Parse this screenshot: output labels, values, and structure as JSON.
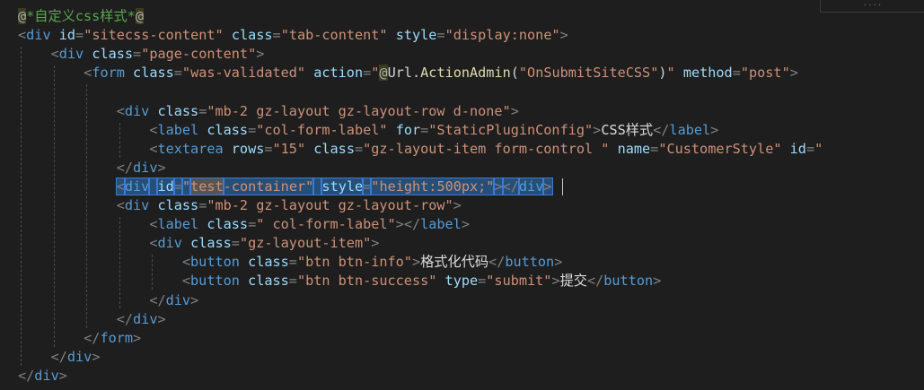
{
  "editor": {
    "scroll_hint": "....",
    "lines": [
      [
        {
          "t": "razor",
          "v": "@"
        },
        {
          "t": "comment",
          "v": "*自定义css样式*"
        },
        {
          "t": "razor",
          "v": "@"
        }
      ],
      [
        {
          "t": "punc",
          "v": "<"
        },
        {
          "t": "tag",
          "v": "div"
        },
        {
          "t": "plain",
          "v": " "
        },
        {
          "t": "attr",
          "v": "id"
        },
        {
          "t": "punc",
          "v": "="
        },
        {
          "t": "str",
          "v": "\"sitecss-content\""
        },
        {
          "t": "plain",
          "v": " "
        },
        {
          "t": "attr",
          "v": "class"
        },
        {
          "t": "punc",
          "v": "="
        },
        {
          "t": "str",
          "v": "\"tab-content\""
        },
        {
          "t": "plain",
          "v": " "
        },
        {
          "t": "attr",
          "v": "style"
        },
        {
          "t": "punc",
          "v": "="
        },
        {
          "t": "str",
          "v": "\"display:none\""
        },
        {
          "t": "punc",
          "v": ">"
        }
      ],
      [
        {
          "t": "plain",
          "v": "    "
        },
        {
          "t": "punc",
          "v": "<"
        },
        {
          "t": "tag",
          "v": "div"
        },
        {
          "t": "plain",
          "v": " "
        },
        {
          "t": "attr",
          "v": "class"
        },
        {
          "t": "punc",
          "v": "="
        },
        {
          "t": "str",
          "v": "\"page-content\""
        },
        {
          "t": "punc",
          "v": ">"
        }
      ],
      [
        {
          "t": "plain",
          "v": "        "
        },
        {
          "t": "punc",
          "v": "<"
        },
        {
          "t": "tag",
          "v": "form"
        },
        {
          "t": "plain",
          "v": " "
        },
        {
          "t": "attr",
          "v": "class"
        },
        {
          "t": "punc",
          "v": "="
        },
        {
          "t": "str",
          "v": "\"was-validated\""
        },
        {
          "t": "plain",
          "v": " "
        },
        {
          "t": "attr",
          "v": "action"
        },
        {
          "t": "punc",
          "v": "="
        },
        {
          "t": "str",
          "v": "\""
        },
        {
          "t": "razor",
          "v": "@"
        },
        {
          "t": "plain",
          "v": "Url."
        },
        {
          "t": "method",
          "v": "ActionAdmin"
        },
        {
          "t": "plain",
          "v": "("
        },
        {
          "t": "str",
          "v": "\"OnSubmitSiteCSS\""
        },
        {
          "t": "plain",
          "v": ")"
        },
        {
          "t": "str",
          "v": "\""
        },
        {
          "t": "plain",
          "v": " "
        },
        {
          "t": "attr",
          "v": "method"
        },
        {
          "t": "punc",
          "v": "="
        },
        {
          "t": "str",
          "v": "\"post\""
        },
        {
          "t": "punc",
          "v": ">"
        }
      ],
      [],
      [
        {
          "t": "plain",
          "v": "            "
        },
        {
          "t": "punc",
          "v": "<"
        },
        {
          "t": "tag",
          "v": "div"
        },
        {
          "t": "plain",
          "v": " "
        },
        {
          "t": "attr",
          "v": "class"
        },
        {
          "t": "punc",
          "v": "="
        },
        {
          "t": "str",
          "v": "\"mb-2 gz-layout gz-layout-row d-none\""
        },
        {
          "t": "punc",
          "v": ">"
        }
      ],
      [
        {
          "t": "plain",
          "v": "                "
        },
        {
          "t": "punc",
          "v": "<"
        },
        {
          "t": "tag",
          "v": "label"
        },
        {
          "t": "plain",
          "v": " "
        },
        {
          "t": "attr",
          "v": "class"
        },
        {
          "t": "punc",
          "v": "="
        },
        {
          "t": "str",
          "v": "\"col-form-label\""
        },
        {
          "t": "plain",
          "v": " "
        },
        {
          "t": "attr",
          "v": "for"
        },
        {
          "t": "punc",
          "v": "="
        },
        {
          "t": "str",
          "v": "\"StaticPluginConfig\""
        },
        {
          "t": "punc",
          "v": ">"
        },
        {
          "t": "text",
          "v": "CSS样式"
        },
        {
          "t": "punc",
          "v": "</"
        },
        {
          "t": "tag",
          "v": "label"
        },
        {
          "t": "punc",
          "v": ">"
        }
      ],
      [
        {
          "t": "plain",
          "v": "                "
        },
        {
          "t": "punc",
          "v": "<"
        },
        {
          "t": "tag",
          "v": "textarea"
        },
        {
          "t": "plain",
          "v": " "
        },
        {
          "t": "attr",
          "v": "rows"
        },
        {
          "t": "punc",
          "v": "="
        },
        {
          "t": "str",
          "v": "\"15\""
        },
        {
          "t": "plain",
          "v": " "
        },
        {
          "t": "attr",
          "v": "class"
        },
        {
          "t": "punc",
          "v": "="
        },
        {
          "t": "str",
          "v": "\"gz-layout-item form-control \""
        },
        {
          "t": "plain",
          "v": " "
        },
        {
          "t": "attr",
          "v": "name"
        },
        {
          "t": "punc",
          "v": "="
        },
        {
          "t": "str",
          "v": "\"CustomerStyle\""
        },
        {
          "t": "plain",
          "v": " "
        },
        {
          "t": "attr",
          "v": "id"
        },
        {
          "t": "punc",
          "v": "="
        },
        {
          "t": "str",
          "v": "\""
        }
      ],
      [
        {
          "t": "plain",
          "v": "            "
        },
        {
          "t": "punc",
          "v": "</"
        },
        {
          "t": "tag",
          "v": "div"
        },
        {
          "t": "punc",
          "v": ">"
        }
      ],
      [
        {
          "t": "plain",
          "v": "            "
        },
        {
          "t": "punc",
          "v": "<",
          "sel": true
        },
        {
          "t": "tag",
          "v": "div",
          "sel": true
        },
        {
          "t": "plain",
          "v": " ",
          "sel": true
        },
        {
          "t": "attr",
          "v": "id",
          "sel": true
        },
        {
          "t": "punc",
          "v": "=",
          "sel": true
        },
        {
          "t": "str",
          "v": "\"",
          "sel": true
        },
        {
          "t": "str",
          "v": "test",
          "sel": true,
          "hl": true
        },
        {
          "t": "str",
          "v": "-container\"",
          "sel": true
        },
        {
          "t": "plain",
          "v": " ",
          "sel": true
        },
        {
          "t": "attr",
          "v": "style",
          "sel": true
        },
        {
          "t": "punc",
          "v": "=",
          "sel": true
        },
        {
          "t": "str",
          "v": "\"height:500px;\"",
          "sel": true
        },
        {
          "t": "punc",
          "v": ">",
          "sel": true
        },
        {
          "t": "punc",
          "v": "</",
          "sel": true
        },
        {
          "t": "tag",
          "v": "div",
          "sel": true
        },
        {
          "t": "punc",
          "v": ">",
          "sel": true
        }
      ],
      [
        {
          "t": "plain",
          "v": "            "
        },
        {
          "t": "punc",
          "v": "<"
        },
        {
          "t": "tag",
          "v": "div"
        },
        {
          "t": "plain",
          "v": " "
        },
        {
          "t": "attr",
          "v": "class"
        },
        {
          "t": "punc",
          "v": "="
        },
        {
          "t": "str",
          "v": "\"mb-2 gz-layout gz-layout-row\""
        },
        {
          "t": "punc",
          "v": ">"
        }
      ],
      [
        {
          "t": "plain",
          "v": "                "
        },
        {
          "t": "punc",
          "v": "<"
        },
        {
          "t": "tag",
          "v": "label"
        },
        {
          "t": "plain",
          "v": " "
        },
        {
          "t": "attr",
          "v": "class"
        },
        {
          "t": "punc",
          "v": "="
        },
        {
          "t": "str",
          "v": "\" col-form-label\""
        },
        {
          "t": "punc",
          "v": "></"
        },
        {
          "t": "tag",
          "v": "label"
        },
        {
          "t": "punc",
          "v": ">"
        }
      ],
      [
        {
          "t": "plain",
          "v": "                "
        },
        {
          "t": "punc",
          "v": "<"
        },
        {
          "t": "tag",
          "v": "div"
        },
        {
          "t": "plain",
          "v": " "
        },
        {
          "t": "attr",
          "v": "class"
        },
        {
          "t": "punc",
          "v": "="
        },
        {
          "t": "str",
          "v": "\"gz-layout-item\""
        },
        {
          "t": "punc",
          "v": ">"
        }
      ],
      [
        {
          "t": "plain",
          "v": "                    "
        },
        {
          "t": "punc",
          "v": "<"
        },
        {
          "t": "tag",
          "v": "button"
        },
        {
          "t": "plain",
          "v": " "
        },
        {
          "t": "attr",
          "v": "class"
        },
        {
          "t": "punc",
          "v": "="
        },
        {
          "t": "str",
          "v": "\"btn btn-info\""
        },
        {
          "t": "punc",
          "v": ">"
        },
        {
          "t": "text",
          "v": "格式化代码"
        },
        {
          "t": "punc",
          "v": "</"
        },
        {
          "t": "tag",
          "v": "button"
        },
        {
          "t": "punc",
          "v": ">"
        }
      ],
      [
        {
          "t": "plain",
          "v": "                    "
        },
        {
          "t": "punc",
          "v": "<"
        },
        {
          "t": "tag",
          "v": "button"
        },
        {
          "t": "plain",
          "v": " "
        },
        {
          "t": "attr",
          "v": "class"
        },
        {
          "t": "punc",
          "v": "="
        },
        {
          "t": "str",
          "v": "\"btn btn-success\""
        },
        {
          "t": "plain",
          "v": " "
        },
        {
          "t": "attr",
          "v": "type"
        },
        {
          "t": "punc",
          "v": "="
        },
        {
          "t": "str",
          "v": "\"submit\""
        },
        {
          "t": "punc",
          "v": ">"
        },
        {
          "t": "text",
          "v": "提交"
        },
        {
          "t": "punc",
          "v": "</"
        },
        {
          "t": "tag",
          "v": "button"
        },
        {
          "t": "punc",
          "v": ">"
        }
      ],
      [
        {
          "t": "plain",
          "v": "                "
        },
        {
          "t": "punc",
          "v": "</"
        },
        {
          "t": "tag",
          "v": "div"
        },
        {
          "t": "punc",
          "v": ">"
        }
      ],
      [
        {
          "t": "plain",
          "v": "            "
        },
        {
          "t": "punc",
          "v": "</"
        },
        {
          "t": "tag",
          "v": "div"
        },
        {
          "t": "punc",
          "v": ">"
        }
      ],
      [
        {
          "t": "plain",
          "v": "        "
        },
        {
          "t": "punc",
          "v": "</"
        },
        {
          "t": "tag",
          "v": "form"
        },
        {
          "t": "punc",
          "v": ">"
        }
      ],
      [
        {
          "t": "plain",
          "v": "    "
        },
        {
          "t": "punc",
          "v": "</"
        },
        {
          "t": "tag",
          "v": "div"
        },
        {
          "t": "punc",
          "v": ">"
        }
      ],
      [
        {
          "t": "punc",
          "v": "</"
        },
        {
          "t": "tag",
          "v": "div"
        },
        {
          "t": "punc",
          "v": ">"
        }
      ]
    ]
  }
}
